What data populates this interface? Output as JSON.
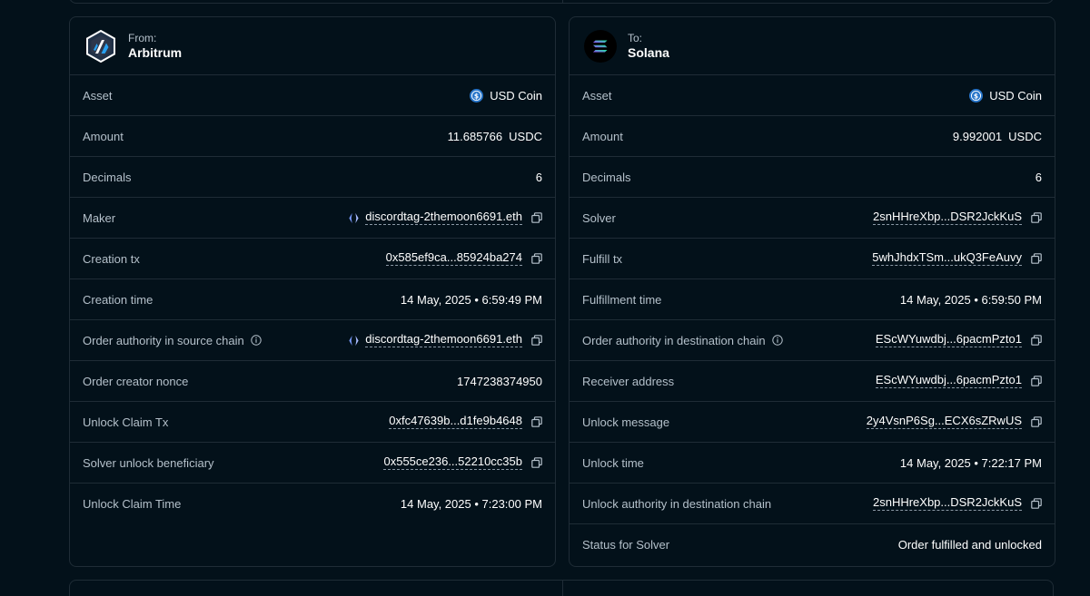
{
  "source": {
    "direction": "From:",
    "chain": "Arbitrum",
    "rows": {
      "asset": {
        "label": "Asset",
        "value": "USD Coin"
      },
      "amount": {
        "label": "Amount",
        "value": "11.685766",
        "unit": "USDC"
      },
      "decimals": {
        "label": "Decimals",
        "value": "6"
      },
      "maker": {
        "label": "Maker",
        "value": "discordtag-2themoon6691.eth"
      },
      "creation_tx": {
        "label": "Creation tx",
        "value": "0x585ef9ca...85924ba274"
      },
      "creation_time": {
        "label": "Creation time",
        "value": "14 May, 2025 • 6:59:49 PM"
      },
      "order_authority": {
        "label": "Order authority in source chain",
        "value": "discordtag-2themoon6691.eth"
      },
      "nonce": {
        "label": "Order creator nonce",
        "value": "1747238374950"
      },
      "unlock_claim_tx": {
        "label": "Unlock Claim Tx",
        "value": "0xfc47639b...d1fe9b4648"
      },
      "beneficiary": {
        "label": "Solver unlock beneficiary",
        "value": "0x555ce236...52210cc35b"
      },
      "unlock_claim_time": {
        "label": "Unlock Claim Time",
        "value": "14 May, 2025 • 7:23:00 PM"
      }
    }
  },
  "destination": {
    "direction": "To:",
    "chain": "Solana",
    "rows": {
      "asset": {
        "label": "Asset",
        "value": "USD Coin"
      },
      "amount": {
        "label": "Amount",
        "value": "9.992001",
        "unit": "USDC"
      },
      "decimals": {
        "label": "Decimals",
        "value": "6"
      },
      "solver": {
        "label": "Solver",
        "value": "2snHHreXbp...DSR2JckKuS"
      },
      "fulfill_tx": {
        "label": "Fulfill tx",
        "value": "5whJhdxTSm...ukQ3FeAuvy"
      },
      "fulfillment_time": {
        "label": "Fulfillment time",
        "value": "14 May, 2025 • 6:59:50 PM"
      },
      "order_authority": {
        "label": "Order authority in destination chain",
        "value": "EScWYuwdbj...6pacmPzto1"
      },
      "receiver": {
        "label": "Receiver address",
        "value": "EScWYuwdbj...6pacmPzto1"
      },
      "unlock_message": {
        "label": "Unlock message",
        "value": "2y4VsnP6Sg...ECX6sZRwUS"
      },
      "unlock_time": {
        "label": "Unlock time",
        "value": "14 May, 2025 • 7:22:17 PM"
      },
      "unlock_authority": {
        "label": "Unlock authority in destination chain",
        "value": "2snHHreXbp...DSR2JckKuS"
      },
      "status": {
        "label": "Status for Solver",
        "value": "Order fulfilled and unlocked"
      }
    }
  },
  "icons": {
    "source_logo": "arbitrum-logo",
    "destination_logo": "solana-logo",
    "asset": "usdc-icon",
    "ens": "ens-icon",
    "copy": "copy-icon",
    "info": "info-icon"
  },
  "colors": {
    "background": "#03111a",
    "border": "#1f2c36",
    "label": "#b4c0ca",
    "value": "#ffffff",
    "usdc": "#2775ca"
  }
}
